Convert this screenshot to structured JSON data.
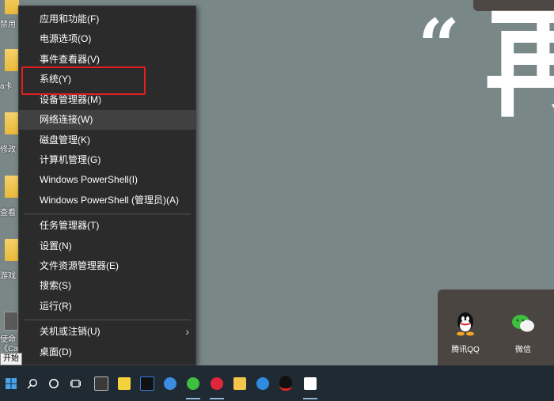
{
  "desktop": {
    "items": [
      {
        "label": "禁用"
      },
      {
        "label": "a卡"
      },
      {
        "label": "修改"
      },
      {
        "label": "查看"
      },
      {
        "label": "游戏"
      }
    ],
    "thumb_label_1": "使命",
    "thumb_label_2": "《Ca"
  },
  "wallpaper": {
    "quote_glyph": "“",
    "big_glyph": "再"
  },
  "menu": {
    "items": [
      {
        "label": "应用和功能(F)"
      },
      {
        "label": "电源选项(O)"
      },
      {
        "label": "事件查看器(V)"
      },
      {
        "label": "系统(Y)"
      },
      {
        "label": "设备管理器(M)"
      },
      {
        "label": "网络连接(W)"
      },
      {
        "label": "磁盘管理(K)"
      },
      {
        "label": "计算机管理(G)"
      },
      {
        "label": "Windows PowerShell(I)"
      },
      {
        "label": "Windows PowerShell (管理员)(A)"
      },
      {
        "label": "任务管理器(T)"
      },
      {
        "label": "设置(N)"
      },
      {
        "label": "文件资源管理器(E)"
      },
      {
        "label": "搜索(S)"
      },
      {
        "label": "运行(R)"
      },
      {
        "label": "关机或注销(U)"
      },
      {
        "label": "桌面(D)"
      }
    ],
    "submenu_arrow": "›"
  },
  "start_tooltip": "开始",
  "notification": {
    "apps": [
      {
        "label": "腾讯QQ",
        "icon": "qq-icon"
      },
      {
        "label": "微信",
        "icon": "wechat-icon"
      }
    ]
  },
  "taskbar": {
    "icons": [
      "windows-start-icon",
      "search-icon",
      "cortana-icon",
      "task-view-icon",
      "calculator-icon",
      "media-player-icon",
      "jetbrains-icon",
      "browser-icon",
      "wechat-icon",
      "netease-music-icon",
      "file-explorer-icon",
      "360-browser-icon",
      "qq-icon",
      "app-icon"
    ]
  },
  "colors": {
    "menu_bg": "#2b2b2b",
    "highlight_border": "#e02020",
    "taskbar_bg": "#1f2a33",
    "desktop_bg": "#7a8787"
  }
}
